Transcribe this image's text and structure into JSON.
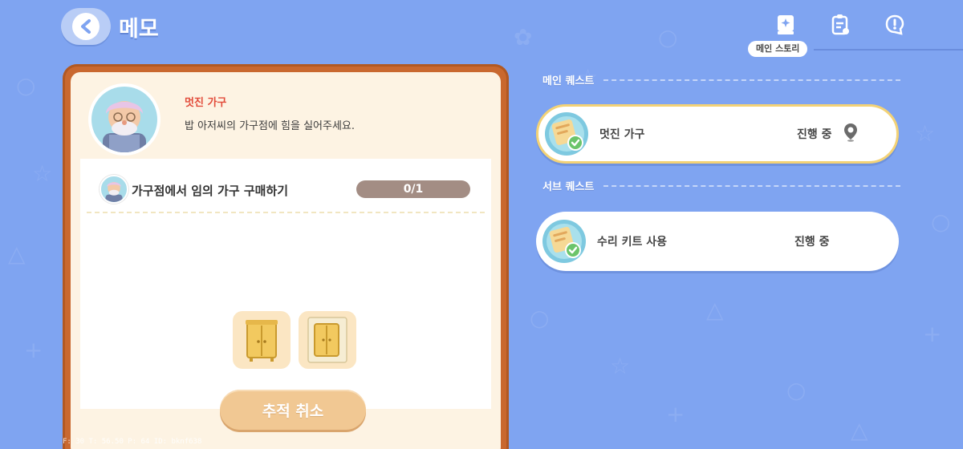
{
  "header": {
    "title": "메모",
    "back_icon": "chevron-left-icon",
    "tab_label": "메인 스토리",
    "icons": [
      "story-book-icon",
      "quest-list-icon",
      "notice-icon"
    ]
  },
  "memo": {
    "quest_title": "멋진 가구",
    "quest_description": "밥 아저씨의 가구점에 힘을 실어주세요.",
    "task": {
      "text": "가구점에서 임의 가구 구매하기",
      "progress": "0/1",
      "progress_fraction": 0
    },
    "reward_items": [
      "wardrobe-icon",
      "wardrobe-blueprint-icon"
    ],
    "cancel_button": "추적 취소"
  },
  "debug_text": "F: 30   T: 56.50   P: 64   ID: bknf638",
  "quest_list": {
    "main_section": "메인 퀘스트",
    "sub_section": "서브 퀘스트",
    "main_quests": [
      {
        "name": "멋진 가구",
        "status": "진행 중",
        "icon": "memo-check-icon",
        "pin_icon": "location-pin-icon"
      }
    ],
    "sub_quests": [
      {
        "name": "수리 키트 사용",
        "status": "진행 중",
        "icon": "memo-check-icon"
      }
    ]
  },
  "colors": {
    "background": "#7fa4f1",
    "card_frame": "#c9682f",
    "card_bg": "#fdf3e3",
    "quest_title": "#e24b3a",
    "active_border": "#f3d276",
    "progress_bar": "#a38d84",
    "cancel_button": "#f1c893"
  }
}
